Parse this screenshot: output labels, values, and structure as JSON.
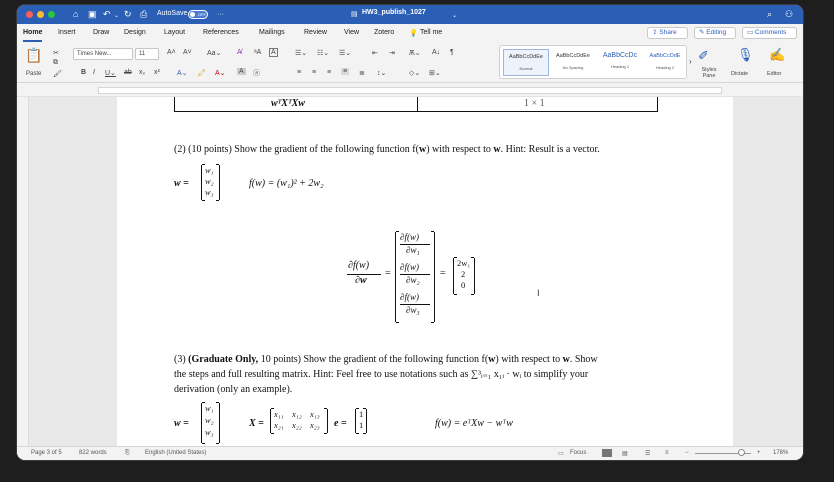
{
  "titlebar": {
    "autosave_label": "AutoSave",
    "autosave_state": "OFF",
    "more": "···",
    "doc_title": "HW3_publish_1027"
  },
  "tabs": [
    "Home",
    "Insert",
    "Draw",
    "Design",
    "Layout",
    "References",
    "Mailings",
    "Review",
    "View",
    "Zotero"
  ],
  "tell_me": "Tell me",
  "share_label": "Share",
  "editing_label": "Editing",
  "comments_label": "Comments",
  "ribbon": {
    "paste": "Paste",
    "font_name": "Times New...",
    "font_size": "11",
    "styles": [
      {
        "preview": "AaBbCcDdEe",
        "name": "Normal"
      },
      {
        "preview": "AaBbCcDdEe",
        "name": "No Spacing"
      },
      {
        "preview": "AaBbCcDc",
        "name": "Heading 1"
      },
      {
        "preview": "AaBbCcDdE",
        "name": "Heading 2"
      }
    ],
    "styles_pane": "Styles Pane",
    "dictate": "Dictate",
    "editor": "Editor"
  },
  "doc": {
    "table_left": "wᵀXᵀXw",
    "table_right": "1 × 1",
    "q2_text_a": "(2) (10 points) Show the gradient of the following function f(",
    "q2_text_w": "w",
    "q2_text_b": ") with respect to ",
    "q2_text_c": ". Hint: Result is a vector.",
    "w_vec": [
      "w₁",
      "w₂",
      "w₃"
    ],
    "f_def": "f(w) = (w₁)² + 2w₂",
    "grad_lhs_num": "∂f(w)",
    "grad_lhs_den": "∂w",
    "grad_num": "∂f(w)",
    "grad_dens": [
      "∂w₁",
      "∂w₂",
      "∂w₃"
    ],
    "grad_result": [
      "2w₁",
      "2",
      "0"
    ],
    "q3_a": "(3) ",
    "q3_bold": "(Graduate Only,",
    "q3_b": " 10 points) Show the gradient of the following function f(",
    "q3_c": ") with respect to ",
    "q3_d": ". Show",
    "q3_line2": "the steps and full resulting matrix. Hint: Feel free to use notations such as ∑³ᵢ₌₁ x₁ᵢ · wᵢ to simplify your",
    "q3_line3": "derivation (only an example).",
    "X_mat": [
      [
        "x₁₁",
        "x₁₂",
        "x₁₃"
      ],
      [
        "x₂₁",
        "x₂₂",
        "x₂₃"
      ]
    ],
    "e_vec": [
      "1",
      "1"
    ],
    "f3_def": "f(w) = eᵀXw − wᵀw"
  },
  "status": {
    "page": "Page 3 of 5",
    "words": "822 words",
    "lang": "English (United States)",
    "focus": "Focus",
    "zoom": "178%"
  }
}
